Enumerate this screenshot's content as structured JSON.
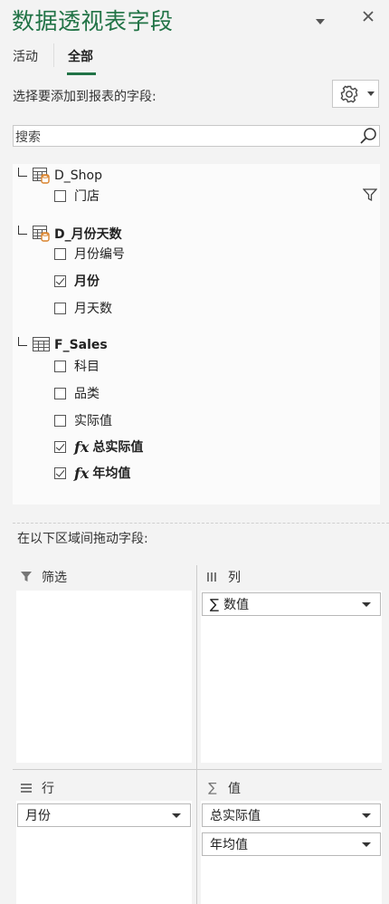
{
  "header": {
    "title": "数据透视表字段"
  },
  "tabs": [
    {
      "label": "活动"
    },
    {
      "label": "全部"
    }
  ],
  "prompt": "选择要添加到报表的字段:",
  "search": {
    "value": "搜索"
  },
  "field_list": {
    "tables": [
      {
        "name": "D_Shop",
        "fields": [
          {
            "label": "门店",
            "checked": false,
            "filtered": true
          }
        ]
      },
      {
        "name": "D_月份天数",
        "fields": [
          {
            "label": "月份编号",
            "checked": false
          },
          {
            "label": "月份",
            "checked": true
          },
          {
            "label": "月天数",
            "checked": false
          }
        ]
      },
      {
        "name": "F_Sales",
        "fields": [
          {
            "label": "科目",
            "checked": false
          },
          {
            "label": "品类",
            "checked": false
          },
          {
            "label": "实际值",
            "checked": false
          },
          {
            "label": "总实际值",
            "checked": true,
            "measure": true
          },
          {
            "label": "年均值",
            "checked": true,
            "measure": true
          }
        ]
      }
    ],
    "fx_symbol": "fx"
  },
  "areas": {
    "label": "在以下区域间拖动字段:",
    "filters": {
      "title": "筛选",
      "items": []
    },
    "columns": {
      "title": "列",
      "items": [
        {
          "label": "数值"
        }
      ]
    },
    "rows": {
      "title": "行",
      "items": [
        {
          "label": "月份"
        }
      ]
    },
    "values": {
      "title": "值",
      "items": [
        {
          "label": "总实际值"
        },
        {
          "label": "年均值"
        }
      ]
    }
  },
  "colors": {
    "accent": "#217346"
  }
}
